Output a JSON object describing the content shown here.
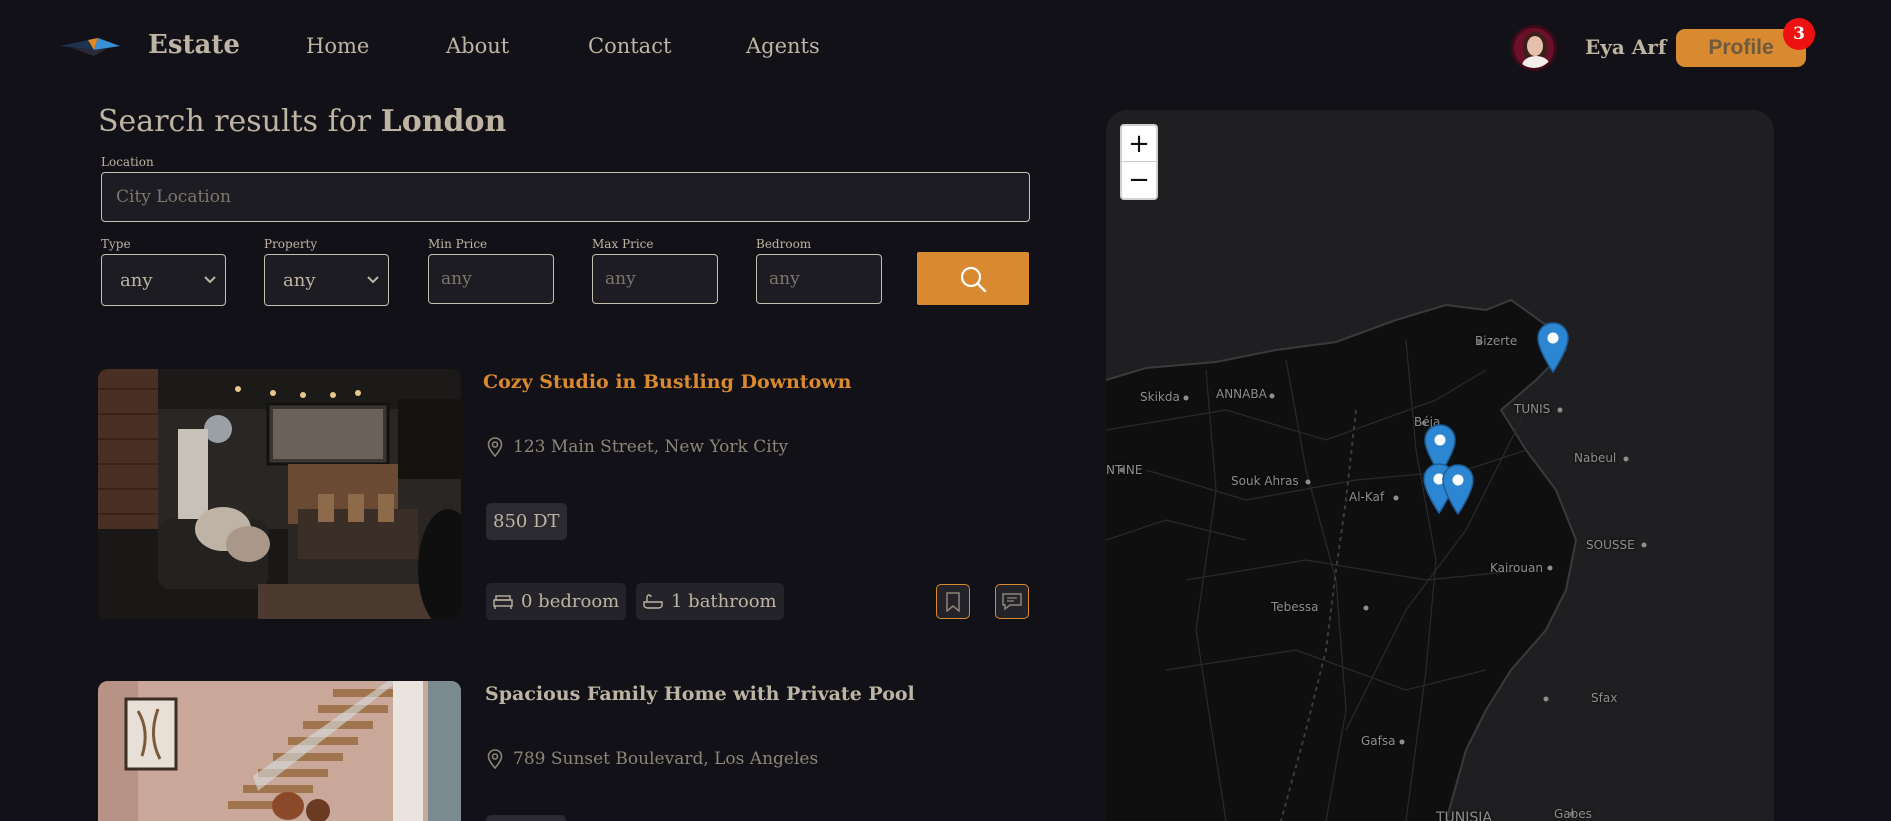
{
  "nav": {
    "brand": "Estate",
    "links": [
      "Home",
      "About",
      "Contact",
      "Agents"
    ],
    "username": "Eya Arf",
    "profile_label": "Profile",
    "notification_count": "3"
  },
  "search": {
    "title_prefix": "Search results for",
    "title_city": "London",
    "location_label": "Location",
    "location_placeholder": "City Location",
    "type_label": "Type",
    "type_value": "any",
    "property_label": "Property",
    "property_value": "any",
    "min_price_label": "Min Price",
    "min_price_placeholder": "any",
    "max_price_label": "Max Price",
    "max_price_placeholder": "any",
    "bedroom_label": "Bedroom",
    "bedroom_placeholder": "any"
  },
  "listings": [
    {
      "title": "Cozy Studio in Bustling Downtown",
      "address": "123 Main Street, New York City",
      "price": "850 DT",
      "bedrooms": "0 bedroom",
      "bathrooms": "1 bathroom",
      "title_color": "#d9892f"
    },
    {
      "title": "Spacious Family Home with Private Pool",
      "address": "789 Sunset Boulevard, Los Angeles",
      "title_color": "#bdb4a3"
    }
  ],
  "map": {
    "zoom_in": "+",
    "zoom_out": "−",
    "labels": [
      "Bizerte",
      "Skikda",
      "ANNABA",
      "TUNIS",
      "Béja",
      "NTINE",
      "Souk Ahras",
      "Al-Kaf",
      "Nabeul",
      "SOUSSE",
      "Kairouan",
      "Tebessa",
      "Sfax",
      "Gafsa",
      "Gabes",
      "TUNISIA"
    ],
    "marker_color": "#2d86d2"
  },
  "colors": {
    "background": "#121117",
    "accent": "#d9892f",
    "text": "#bdb4a3",
    "badge": "#ee1111"
  }
}
